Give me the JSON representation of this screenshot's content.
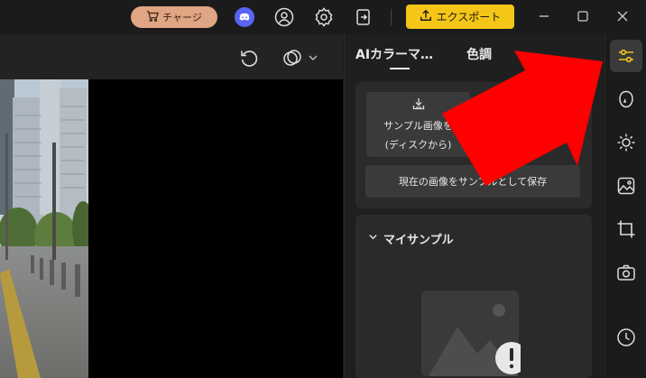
{
  "titlebar": {
    "charge_label": "チャージ",
    "export_label": "エクスポート",
    "icons": [
      "cart-icon",
      "discord-icon",
      "user-icon",
      "settings-icon",
      "login-icon",
      "upload-icon",
      "minimize-icon",
      "maximize-icon",
      "close-icon"
    ]
  },
  "canvas_toolbar": {
    "icons": [
      "reset-icon",
      "compare-icon",
      "chevron-down-icon"
    ]
  },
  "panel": {
    "tabs": [
      {
        "label": "AIカラーマ…",
        "active": true
      },
      {
        "label": "色調"
      }
    ],
    "sample_load": {
      "line1": "サンプル画像を",
      "line2": "(ディスクから)"
    },
    "sample_save_label": "現在の画像をサンプルとして保存",
    "my_samples_title": "マイサンプル"
  },
  "rail": {
    "items": [
      "adjust-icon",
      "face-icon",
      "brightness-icon",
      "image-edit-icon",
      "crop-icon",
      "camera-icon",
      "history-icon"
    ],
    "active_index": 0
  },
  "colors": {
    "accent": "#f5c518",
    "charge_bg": "#e0a582",
    "discord": "#5865f2",
    "arrow": "#ff0000"
  }
}
